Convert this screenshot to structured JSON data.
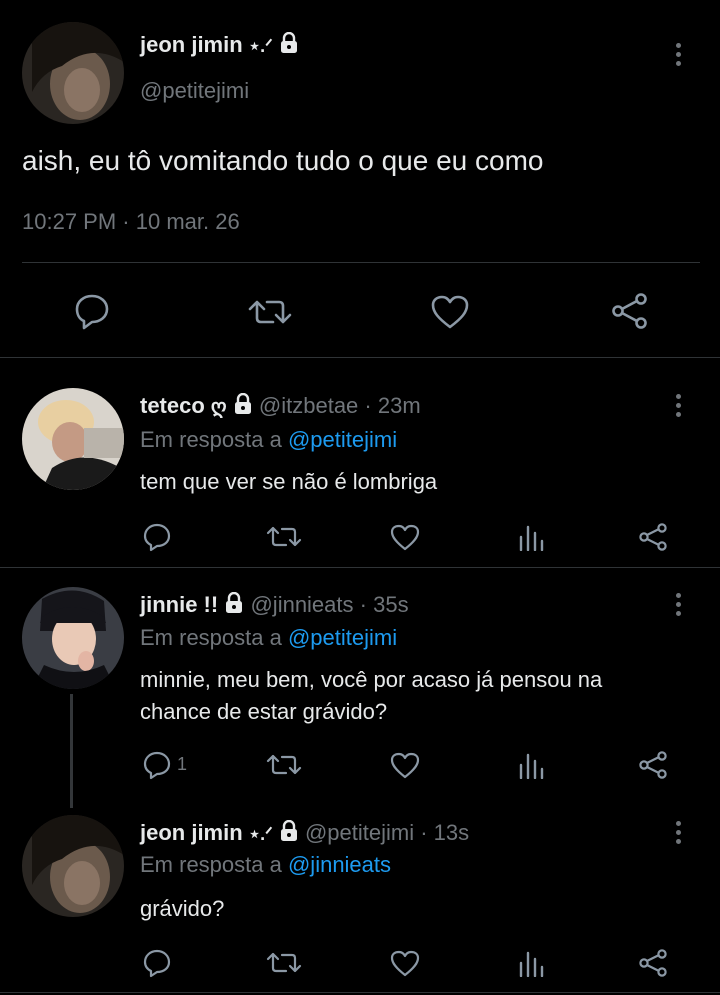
{
  "main_tweet": {
    "display_name": "jeon jimin",
    "name_decoration": "⋆.ᐟ",
    "handle": "@petitejimi",
    "text": "aish, eu tô vomitando tudo o que eu como",
    "time": "10:27 PM",
    "separator": "·",
    "date": "10 mar. 26"
  },
  "replies": [
    {
      "display_name": "teteco",
      "name_decoration": "ღ",
      "handle": "@itzbetae",
      "separator": "·",
      "age": "23m",
      "reply_prefix": "Em resposta a",
      "reply_to": "@petitejimi",
      "text": "tem que ver se não é lombriga",
      "reply_count": ""
    },
    {
      "display_name": "jinnie !!",
      "name_decoration": "",
      "handle": "@jinnieats",
      "separator": "·",
      "age": "35s",
      "reply_prefix": "Em resposta a",
      "reply_to": "@petitejimi",
      "text_line1": "minnie, meu bem, você por acaso já pensou na",
      "text_line2": "chance de estar grávido?",
      "reply_count": "1"
    },
    {
      "display_name": "jeon jimin",
      "name_decoration": "⋆.ᐟ",
      "handle": "@petitejimi",
      "separator": "·",
      "age": "13s",
      "reply_prefix": "Em resposta a",
      "reply_to": "@jinnieats",
      "text": "grávido?",
      "reply_count": ""
    }
  ],
  "icons": {
    "reply": "reply-icon",
    "retweet": "retweet-icon",
    "like": "like-icon",
    "analytics": "analytics-icon",
    "share": "share-icon",
    "lock": "lock-icon",
    "more": "more-icon"
  },
  "colors": {
    "background": "#000000",
    "text": "#e7e9ea",
    "muted": "#71767b",
    "link": "#1d9bf0",
    "divider": "#2f3336"
  }
}
